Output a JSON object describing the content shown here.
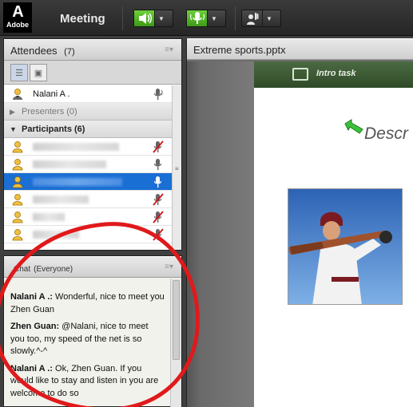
{
  "topbar": {
    "logo_mark": "A",
    "logo_word": "Adobe",
    "meeting_label": "Meeting",
    "icons": [
      "speaker-icon",
      "microphone-icon",
      "raise-hand-icon",
      "chevron-down-icon"
    ],
    "accent": "#4fb521"
  },
  "attendees": {
    "title": "Attendees",
    "count": "(7)",
    "host": {
      "name": "Nalani A ."
    },
    "presenters_label": "Presenters (0)",
    "participants_label": "Participants (6)",
    "participants": [
      {
        "name": "",
        "mic": "muted",
        "selected": false
      },
      {
        "name": "",
        "mic": "active",
        "selected": false
      },
      {
        "name": "",
        "mic": "active",
        "selected": true
      },
      {
        "name": "",
        "mic": "muted",
        "selected": false
      },
      {
        "name": "",
        "mic": "muted",
        "selected": false
      },
      {
        "name": "",
        "mic": "muted",
        "selected": false
      }
    ],
    "selected_color": "#1a6fd4"
  },
  "chat": {
    "title": "Chat",
    "audience": "(Everyone)",
    "messages": [
      {
        "sender": "Nalani A .:",
        "text": " Wonderful, nice to meet you Zhen Guan"
      },
      {
        "sender": "Zhen Guan:",
        "text": " @Nalani, nice to meet you too, my speed of the net is so slowly.^-^"
      },
      {
        "sender": "Nalani A .:",
        "text": " Ok,  Zhen Guan. If  you would like to stay and listen in you are welcome to do so"
      }
    ]
  },
  "share": {
    "title": "Extreme sports.pptx",
    "band_label": "Intro task",
    "slide_title": "Descr",
    "band_color": "#3d5a34"
  },
  "annotation": {
    "color": "#e0191b"
  }
}
